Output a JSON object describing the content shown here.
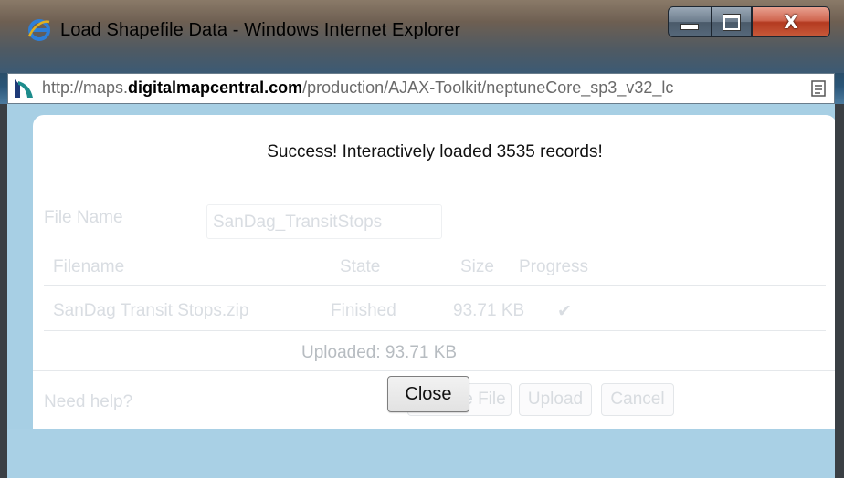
{
  "window": {
    "title": "Load Shapefile Data - Windows Internet Explorer",
    "controls": {
      "minimize": "minimize",
      "maximize": "maximize",
      "close": "X"
    }
  },
  "addressbar": {
    "url_prefix": "http://maps.",
    "url_domain": "digitalmapcentral.com",
    "url_path": "/production/AJAX-Toolkit/neptuneCore_sp3_v32_lc"
  },
  "dialog": {
    "message": "Success! Interactively loaded 3535 records!",
    "faded": {
      "file_name_label": "File Name",
      "file_name_value": "SanDag_TransitStops",
      "columns": [
        "Filename",
        "State",
        "Size",
        "Progress"
      ],
      "row": {
        "filename": "SanDag Transit Stops.zip",
        "state": "Finished",
        "size": "93.71 KB",
        "progress": "✔"
      },
      "help_link": "Need help?",
      "choose_file": "Choose File",
      "upload": "Upload",
      "cancel": "Cancel"
    },
    "uploaded": "Uploaded: 93.71 KB",
    "close_button": "Close"
  },
  "colors": {
    "content_bg": "#a7cfe4",
    "dialog_bg": "#ffffff",
    "close_btn_red": "#c85a3a"
  }
}
